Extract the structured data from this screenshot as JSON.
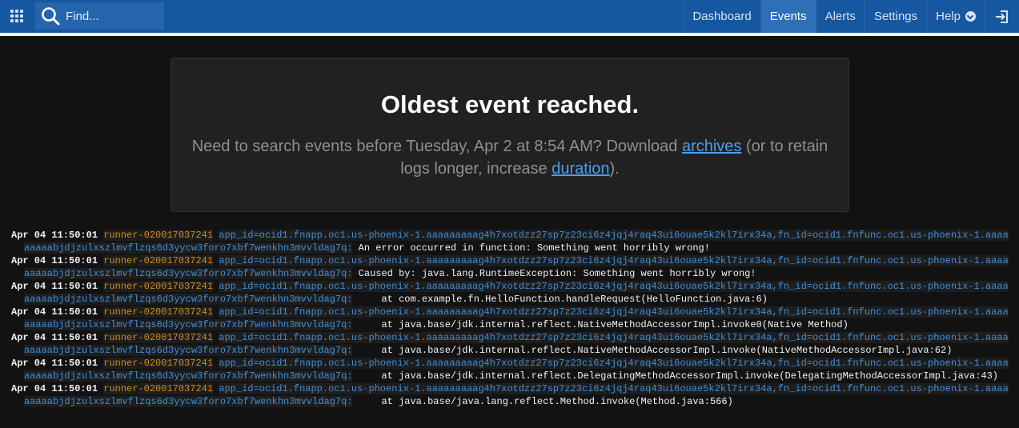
{
  "search": {
    "placeholder": "Find..."
  },
  "nav": {
    "items": [
      {
        "label": "Dashboard",
        "active": false
      },
      {
        "label": "Events",
        "active": true
      },
      {
        "label": "Alerts",
        "active": false
      },
      {
        "label": "Settings",
        "active": false
      },
      {
        "label": "Help",
        "active": false
      }
    ]
  },
  "notice": {
    "title": "Oldest event reached.",
    "text_before": "Need to search events before Tuesday, Apr 2 at 8:54 AM? Download ",
    "link_archives": "archives",
    "text_middle": " (or to retain logs longer, increase ",
    "link_duration": "duration",
    "text_after": ")."
  },
  "colors": {
    "nav_bg": "#1557a0",
    "nav_active": "#2f6fb8",
    "source": "#d38a1c",
    "app": "#3e8fd8",
    "link": "#4b9ef0"
  },
  "logs": [
    {
      "time": "Apr 04 11:50:01",
      "source": "runner-020017037241",
      "app": "app_id=ocid1.fnapp.oc1.us-phoenix-1.aaaaaaaaag4h7xotdzz27sp7z23ci6z4jqj4raq43ui6ouae5k2kl7irx34a,fn_id=ocid1.fnfunc.oc1.us-phoenix-1.aaaaaaaaabjdjzulxszlmvflzqs6d3yycw3foro7xbf7wenkhn3mvvldag7q:",
      "message": " An error occurred in function: Something went horribly wrong!"
    },
    {
      "time": "Apr 04 11:50:01",
      "source": "runner-020017037241",
      "app": "app_id=ocid1.fnapp.oc1.us-phoenix-1.aaaaaaaaag4h7xotdzz27sp7z23ci6z4jqj4raq43ui6ouae5k2kl7irx34a,fn_id=ocid1.fnfunc.oc1.us-phoenix-1.aaaaaaaaabjdjzulxszlmvflzqs6d3yycw3foro7xbf7wenkhn3mvvldag7q:",
      "message": " Caused by: java.lang.RuntimeException: Something went horribly wrong!"
    },
    {
      "time": "Apr 04 11:50:01",
      "source": "runner-020017037241",
      "app": "app_id=ocid1.fnapp.oc1.us-phoenix-1.aaaaaaaaag4h7xotdzz27sp7z23ci6z4jqj4raq43ui6ouae5k2kl7irx34a,fn_id=ocid1.fnfunc.oc1.us-phoenix-1.aaaaaaaaabjdjzulxszlmvflzqs6d3yycw3foro7xbf7wenkhn3mvvldag7q:",
      "message": "     at com.example.fn.HelloFunction.handleRequest(HelloFunction.java:6)"
    },
    {
      "time": "Apr 04 11:50:01",
      "source": "runner-020017037241",
      "app": "app_id=ocid1.fnapp.oc1.us-phoenix-1.aaaaaaaaag4h7xotdzz27sp7z23ci6z4jqj4raq43ui6ouae5k2kl7irx34a,fn_id=ocid1.fnfunc.oc1.us-phoenix-1.aaaaaaaaabjdjzulxszlmvflzqs6d3yycw3foro7xbf7wenkhn3mvvldag7q:",
      "message": "     at java.base/jdk.internal.reflect.NativeMethodAccessorImpl.invoke0(Native Method)"
    },
    {
      "time": "Apr 04 11:50:01",
      "source": "runner-020017037241",
      "app": "app_id=ocid1.fnapp.oc1.us-phoenix-1.aaaaaaaaag4h7xotdzz27sp7z23ci6z4jqj4raq43ui6ouae5k2kl7irx34a,fn_id=ocid1.fnfunc.oc1.us-phoenix-1.aaaaaaaaabjdjzulxszlmvflzqs6d3yycw3foro7xbf7wenkhn3mvvldag7q:",
      "message": "     at java.base/jdk.internal.reflect.NativeMethodAccessorImpl.invoke(NativeMethodAccessorImpl.java:62)"
    },
    {
      "time": "Apr 04 11:50:01",
      "source": "runner-020017037241",
      "app": "app_id=ocid1.fnapp.oc1.us-phoenix-1.aaaaaaaaag4h7xotdzz27sp7z23ci6z4jqj4raq43ui6ouae5k2kl7irx34a,fn_id=ocid1.fnfunc.oc1.us-phoenix-1.aaaaaaaaabjdjzulxszlmvflzqs6d3yycw3foro7xbf7wenkhn3mvvldag7q:",
      "message": "     at java.base/jdk.internal.reflect.DelegatingMethodAccessorImpl.invoke(DelegatingMethodAccessorImpl.java:43)"
    },
    {
      "time": "Apr 04 11:50:01",
      "source": "runner-020017037241",
      "app": "app_id=ocid1.fnapp.oc1.us-phoenix-1.aaaaaaaaag4h7xotdzz27sp7z23ci6z4jqj4raq43ui6ouae5k2kl7irx34a,fn_id=ocid1.fnfunc.oc1.us-phoenix-1.aaaaaaaaabjdjzulxszlmvflzqs6d3yycw3foro7xbf7wenkhn3mvvldag7q:",
      "message": "     at java.base/java.lang.reflect.Method.invoke(Method.java:566)"
    }
  ]
}
